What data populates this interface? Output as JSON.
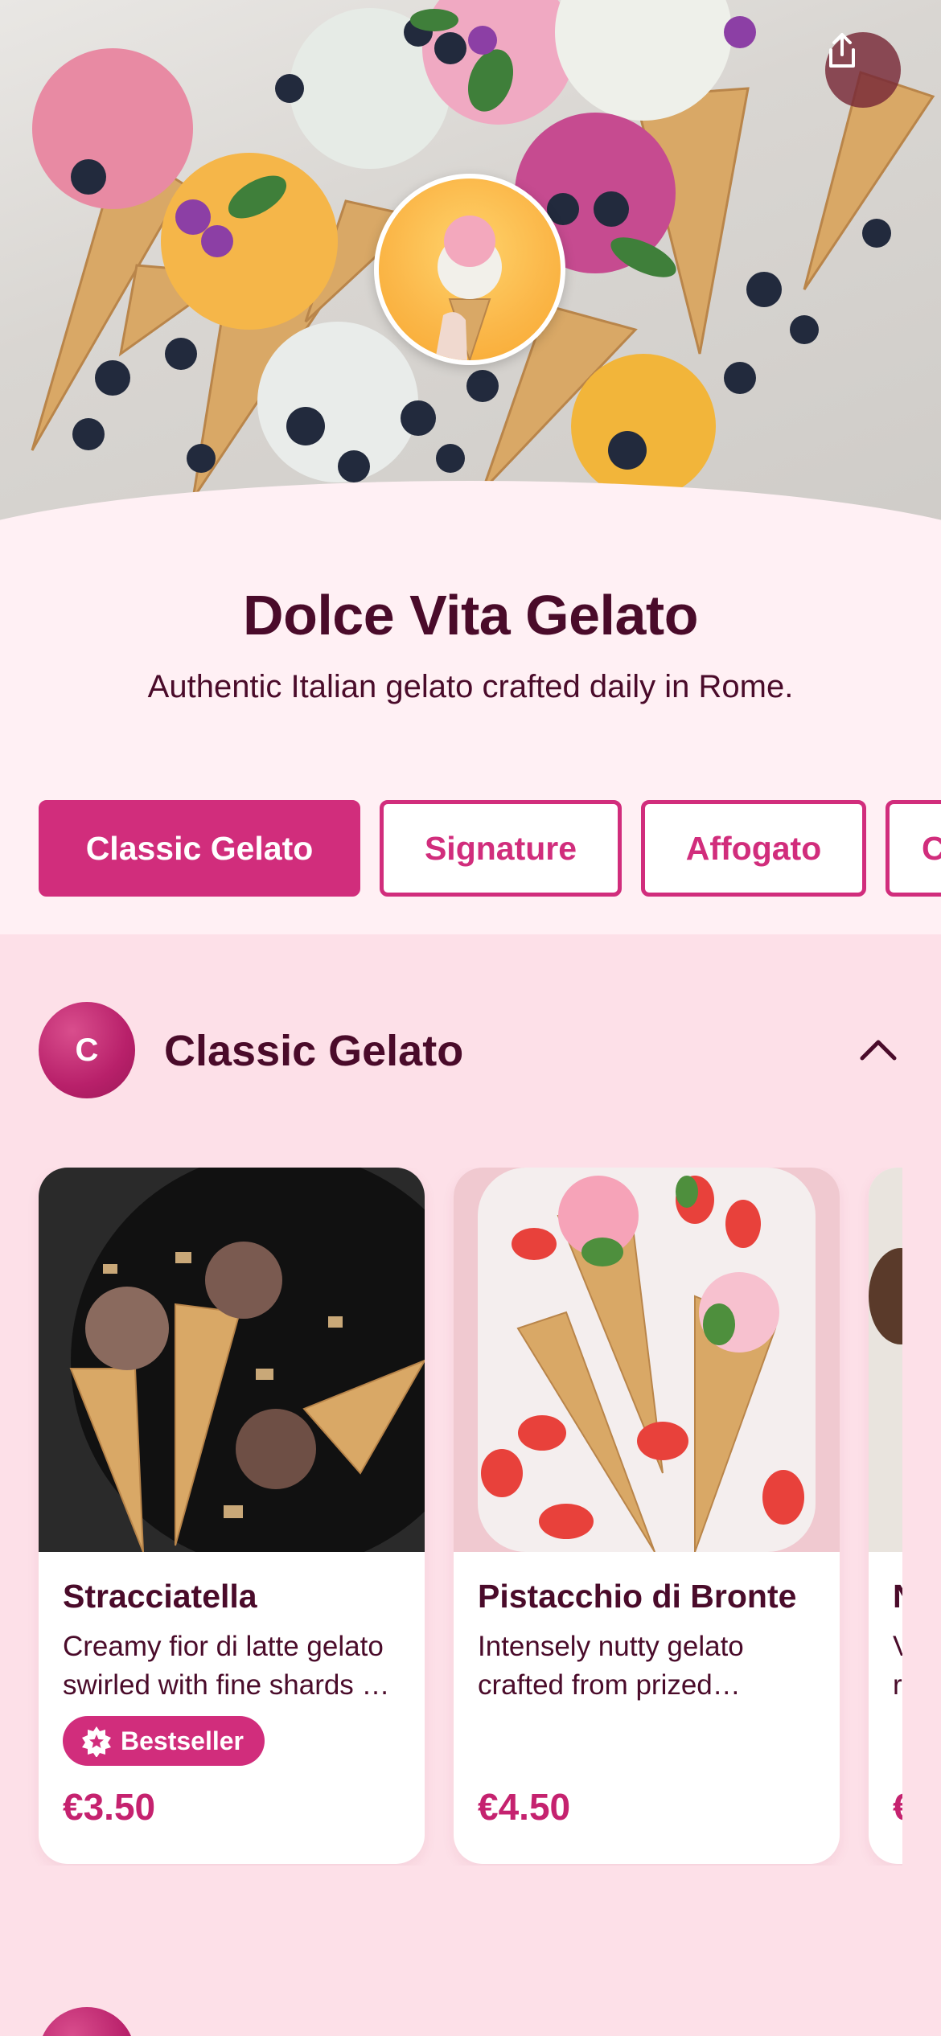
{
  "store": {
    "name": "Dolce Vita Gelato",
    "tagline": "Authentic Italian gelato crafted daily in Rome."
  },
  "hero": {
    "share_icon": "share-icon"
  },
  "tabs": [
    {
      "label": "Classic Gelato",
      "active": true
    },
    {
      "label": "Signature",
      "active": false
    },
    {
      "label": "Affogato",
      "active": false
    },
    {
      "label": "C",
      "active": false
    }
  ],
  "section": {
    "badge_letter": "C",
    "title": "Classic Gelato",
    "toggle_icon": "chevron-up-icon"
  },
  "products": [
    {
      "name": "Stracciatella",
      "description": "Creamy fior di latte gelato swirled with fine shards …",
      "badge": "Bestseller",
      "price": "€3.50"
    },
    {
      "name": "Pistacchio di Bronte",
      "description": "Intensely nutty gelato crafted from prized…",
      "price": "€4.50"
    },
    {
      "name": "N",
      "description": "V\nr",
      "price": "€"
    }
  ],
  "colors": {
    "accent": "#d12d7c",
    "heading": "#4a0b2a",
    "page_bg": "#fde0e8",
    "header_bg": "#fff0f4"
  }
}
